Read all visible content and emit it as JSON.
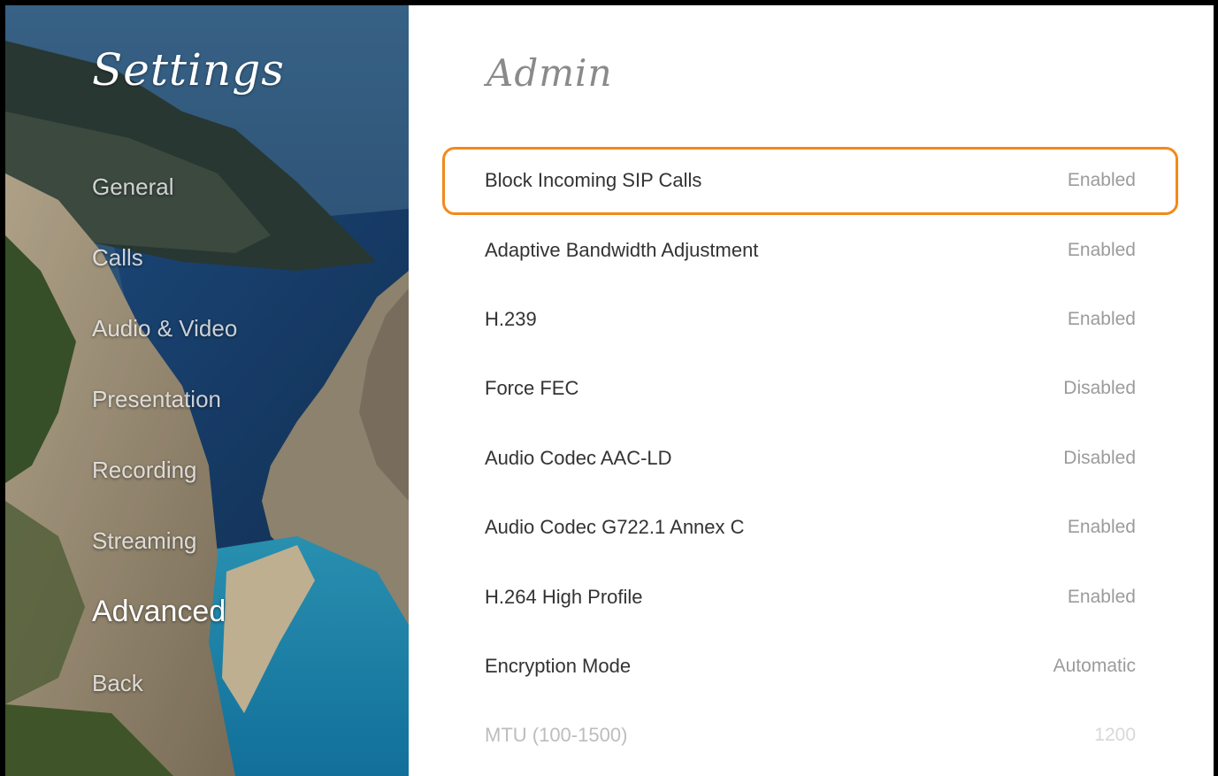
{
  "sidebar": {
    "title": "Settings",
    "items": [
      {
        "label": "General"
      },
      {
        "label": "Calls"
      },
      {
        "label": "Audio & Video"
      },
      {
        "label": "Presentation"
      },
      {
        "label": "Recording"
      },
      {
        "label": "Streaming"
      },
      {
        "label": "Advanced",
        "active": true
      },
      {
        "label": "Back"
      }
    ]
  },
  "main": {
    "title": "Admin",
    "focused_row": 0,
    "rows": [
      {
        "label": "Block Incoming SIP Calls",
        "value": "Enabled"
      },
      {
        "label": "Adaptive Bandwidth Adjustment",
        "value": "Enabled"
      },
      {
        "label": "H.239",
        "value": "Enabled"
      },
      {
        "label": "Force FEC",
        "value": "Disabled"
      },
      {
        "label": "Audio Codec AAC-LD",
        "value": "Disabled"
      },
      {
        "label": "Audio Codec G722.1 Annex C",
        "value": "Enabled"
      },
      {
        "label": "H.264 High Profile",
        "value": "Enabled"
      },
      {
        "label": "Encryption Mode",
        "value": "Automatic"
      },
      {
        "label": "MTU (100-1500)",
        "value": "1200"
      }
    ]
  },
  "colors": {
    "focus_ring": "#f28a1b",
    "label_text": "#333333",
    "value_text": "#9b9b9b",
    "title_text": "#8a8a8a"
  }
}
